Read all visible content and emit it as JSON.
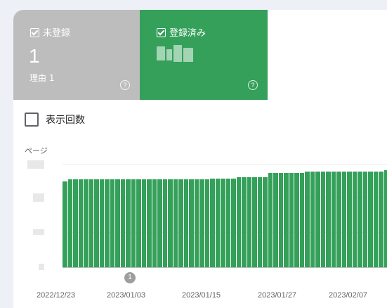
{
  "cards": {
    "not_indexed": {
      "label": "未登録",
      "value": "1",
      "reason": "理由 1"
    },
    "indexed": {
      "label": "登録済み"
    }
  },
  "toggle": {
    "label": "表示回数"
  },
  "chart_data": {
    "type": "bar",
    "ylabel": "ページ",
    "x_labels": [
      "2022/12/23",
      "2023/01/03",
      "2023/01/15",
      "2023/01/27",
      "2023/02/07"
    ],
    "annotation": "1",
    "series": [
      {
        "values": [
          0.76,
          0.78,
          0.78,
          0.78,
          0.78,
          0.78,
          0.78,
          0.78,
          0.78,
          0.78,
          0.78,
          0.78,
          0.78,
          0.78,
          0.78,
          0.78,
          0.78,
          0.78,
          0.78,
          0.78,
          0.78,
          0.78,
          0.78,
          0.78,
          0.78,
          0.78,
          0.78,
          0.78,
          0.79,
          0.79,
          0.79,
          0.79,
          0.79,
          0.8,
          0.8,
          0.8,
          0.8,
          0.8,
          0.8,
          0.84,
          0.84,
          0.84,
          0.84,
          0.84,
          0.84,
          0.84,
          0.85,
          0.85,
          0.85,
          0.85,
          0.85,
          0.85,
          0.85,
          0.85,
          0.85,
          0.85,
          0.85,
          0.85,
          0.85,
          0.85,
          0.85,
          0.86
        ]
      }
    ],
    "colors": {
      "indexed": "#34a05a",
      "not_indexed": "#bdbdbd"
    }
  }
}
